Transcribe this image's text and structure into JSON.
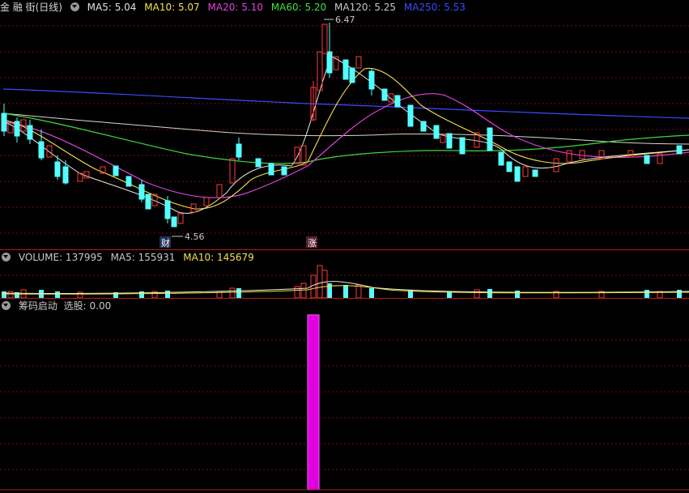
{
  "header": {
    "title": "金 融 街(日线)",
    "ma": [
      {
        "label": "MA5: 5.04",
        "color": "#e0e0e0"
      },
      {
        "label": "MA10: 5.07",
        "color": "#f5e04a"
      },
      {
        "label": "MA20: 5.10",
        "color": "#e040e0"
      },
      {
        "label": "MA60: 5.20",
        "color": "#40e040"
      },
      {
        "label": "MA120: 5.25",
        "color": "#c8c8c8"
      },
      {
        "label": "MA250: 5.53",
        "color": "#3a4aff"
      }
    ]
  },
  "price_chart": {
    "high_label": "6.47",
    "low_label": "4.56",
    "marker_cai": "财",
    "marker_zhang": "涨"
  },
  "volume_panel": {
    "title": "VOLUME: 137995",
    "ma5": "MA5: 155931",
    "ma10": "MA10: 145679"
  },
  "indicator_panel": {
    "title": "筹码启动",
    "select_label": "选股: 0.00"
  },
  "colors": {
    "up": "#ff3c3c",
    "down": "#54ffff",
    "signal": "#e000e0",
    "grid": "#7a1010"
  }
}
